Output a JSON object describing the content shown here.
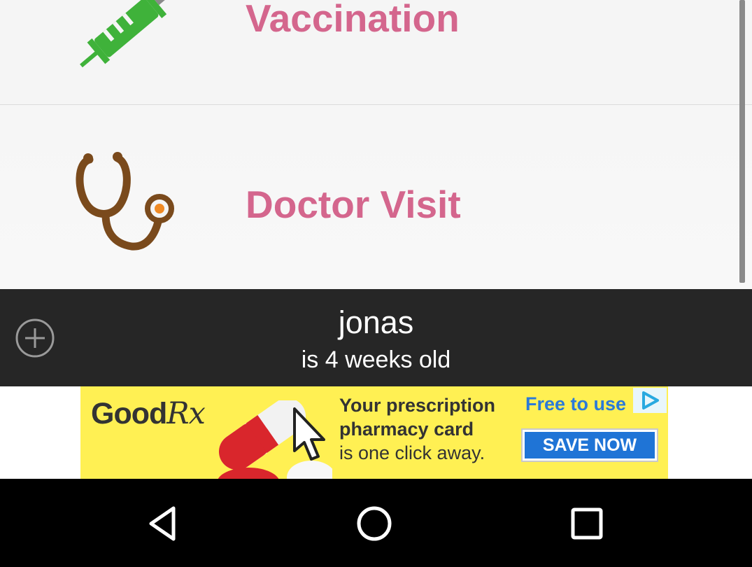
{
  "categories": [
    {
      "label": "Vaccination",
      "icon": "syringe-icon"
    },
    {
      "label": "Doctor Visit",
      "icon": "stethoscope-icon"
    }
  ],
  "header": {
    "name": "jonas",
    "age_text": "is 4 weeks old",
    "add_icon": "add-circle-icon"
  },
  "ad": {
    "logo_text": "Good",
    "logo_rx": "Rx",
    "line1": "Your prescription",
    "line2": "pharmacy card",
    "line3": "is one click away.",
    "free_text": "Free to use",
    "button_label": "SAVE NOW"
  },
  "colors": {
    "label_pink": "#d4668d",
    "syringe_green": "#3fb23a",
    "stethoscope_brown": "#7a4a1c",
    "stethoscope_orange": "#f08a24",
    "header_bg": "#262626",
    "ad_yellow": "#fff053",
    "ad_blue": "#1f74d6"
  },
  "navigation": {
    "back_icon": "back-triangle-icon",
    "home_icon": "home-circle-icon",
    "recents_icon": "recents-square-icon"
  }
}
